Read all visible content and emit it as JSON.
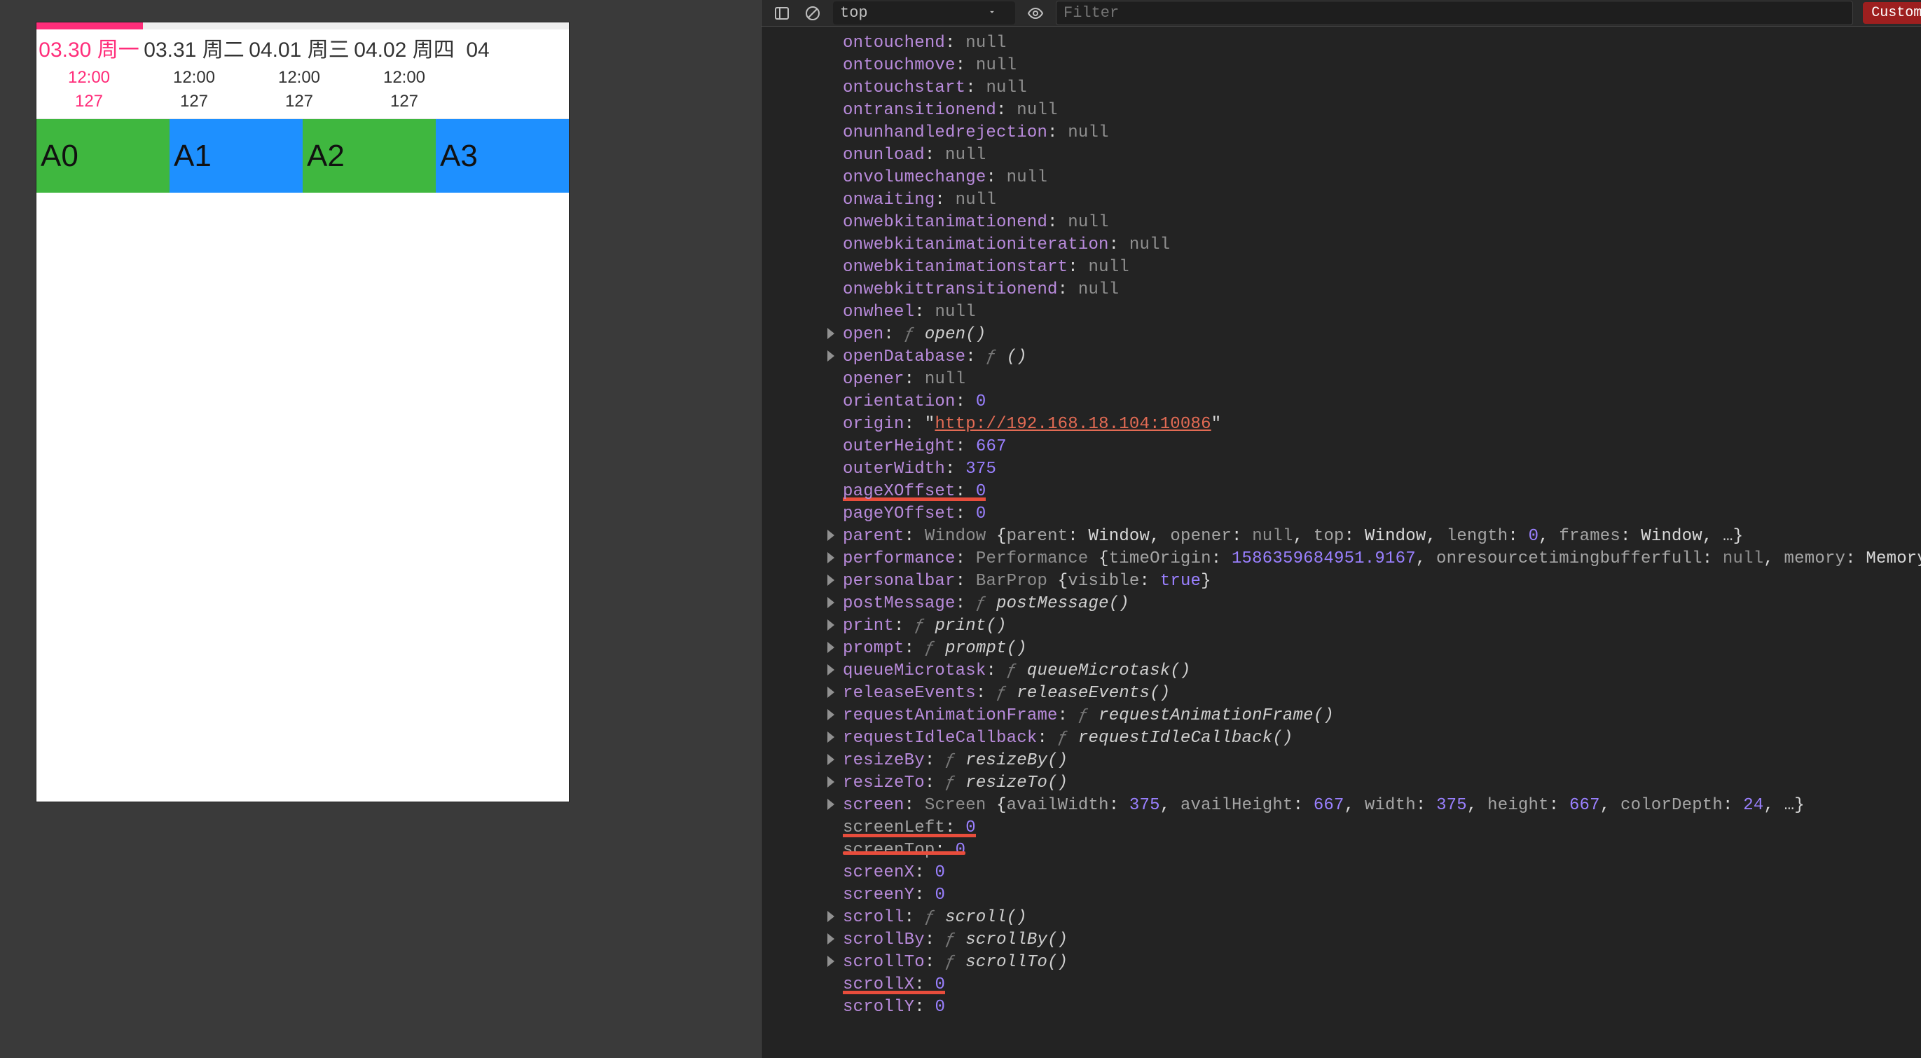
{
  "device": {
    "tabs": [
      {
        "date": "03.30 周一",
        "time": "12:00",
        "count": "127",
        "active": true
      },
      {
        "date": "03.31 周二",
        "time": "12:00",
        "count": "127",
        "active": false
      },
      {
        "date": "04.01 周三",
        "time": "12:00",
        "count": "127",
        "active": false
      },
      {
        "date": "04.02 周四",
        "time": "12:00",
        "count": "127",
        "active": false
      },
      {
        "date": "04",
        "time": "",
        "count": "",
        "active": false
      }
    ],
    "cells": [
      "A0",
      "A1",
      "A2",
      "A3"
    ]
  },
  "toolbar": {
    "context": "top",
    "filter_placeholder": "Filter",
    "badge": "Custom levels"
  },
  "props": [
    {
      "exp": false,
      "key": "ontouchend",
      "kind": "null",
      "val": "null"
    },
    {
      "exp": false,
      "key": "ontouchmove",
      "kind": "null",
      "val": "null"
    },
    {
      "exp": false,
      "key": "ontouchstart",
      "kind": "null",
      "val": "null"
    },
    {
      "exp": false,
      "key": "ontransitionend",
      "kind": "null",
      "val": "null"
    },
    {
      "exp": false,
      "key": "onunhandledrejection",
      "kind": "null",
      "val": "null"
    },
    {
      "exp": false,
      "key": "onunload",
      "kind": "null",
      "val": "null"
    },
    {
      "exp": false,
      "key": "onvolumechange",
      "kind": "null",
      "val": "null"
    },
    {
      "exp": false,
      "key": "onwaiting",
      "kind": "null",
      "val": "null"
    },
    {
      "exp": false,
      "key": "onwebkitanimationend",
      "kind": "null",
      "val": "null"
    },
    {
      "exp": false,
      "key": "onwebkitanimationiteration",
      "kind": "null",
      "val": "null"
    },
    {
      "exp": false,
      "key": "onwebkitanimationstart",
      "kind": "null",
      "val": "null"
    },
    {
      "exp": false,
      "key": "onwebkittransitionend",
      "kind": "null",
      "val": "null"
    },
    {
      "exp": false,
      "key": "onwheel",
      "kind": "null",
      "val": "null"
    },
    {
      "exp": true,
      "key": "open",
      "kind": "fn",
      "val": "open()"
    },
    {
      "exp": true,
      "key": "openDatabase",
      "kind": "fn",
      "val": "()"
    },
    {
      "exp": false,
      "key": "opener",
      "kind": "null",
      "val": "null"
    },
    {
      "exp": false,
      "key": "orientation",
      "kind": "num",
      "val": "0"
    },
    {
      "exp": false,
      "key": "origin",
      "kind": "origin",
      "val": "http://192.168.18.104:10086"
    },
    {
      "exp": false,
      "key": "outerHeight",
      "kind": "num",
      "val": "667"
    },
    {
      "exp": false,
      "key": "outerWidth",
      "kind": "num",
      "val": "375"
    },
    {
      "exp": false,
      "key": "pageXOffset",
      "kind": "num",
      "val": "0",
      "mark": "under"
    },
    {
      "exp": false,
      "key": "pageYOffset",
      "kind": "num",
      "val": "0"
    },
    {
      "exp": true,
      "key": "parent",
      "kind": "parent"
    },
    {
      "exp": true,
      "key": "performance",
      "kind": "performance"
    },
    {
      "exp": true,
      "key": "personalbar",
      "kind": "personalbar"
    },
    {
      "exp": true,
      "key": "postMessage",
      "kind": "fn",
      "val": "postMessage()"
    },
    {
      "exp": true,
      "key": "print",
      "kind": "fn",
      "val": "print()"
    },
    {
      "exp": true,
      "key": "prompt",
      "kind": "fn",
      "val": "prompt()"
    },
    {
      "exp": true,
      "key": "queueMicrotask",
      "kind": "fn",
      "val": "queueMicrotask()"
    },
    {
      "exp": true,
      "key": "releaseEvents",
      "kind": "fn",
      "val": "releaseEvents()"
    },
    {
      "exp": true,
      "key": "requestAnimationFrame",
      "kind": "fn",
      "val": "requestAnimationFrame()"
    },
    {
      "exp": true,
      "key": "requestIdleCallback",
      "kind": "fn",
      "val": "requestIdleCallback()"
    },
    {
      "exp": true,
      "key": "resizeBy",
      "kind": "fn",
      "val": "resizeBy()"
    },
    {
      "exp": true,
      "key": "resizeTo",
      "kind": "fn",
      "val": "resizeTo()"
    },
    {
      "exp": true,
      "key": "screen",
      "kind": "screen"
    },
    {
      "exp": false,
      "key": "screenLeft",
      "kind": "num",
      "val": "0",
      "mark": "under",
      "dim": true
    },
    {
      "exp": false,
      "key": "screenTop",
      "kind": "num",
      "val": "0",
      "mark": "strike",
      "dim": true
    },
    {
      "exp": false,
      "key": "screenX",
      "kind": "num",
      "val": "0"
    },
    {
      "exp": false,
      "key": "screenY",
      "kind": "num",
      "val": "0"
    },
    {
      "exp": true,
      "key": "scroll",
      "kind": "fn",
      "val": "scroll()"
    },
    {
      "exp": true,
      "key": "scrollBy",
      "kind": "fn",
      "val": "scrollBy()"
    },
    {
      "exp": true,
      "key": "scrollTo",
      "kind": "fn",
      "val": "scrollTo()"
    },
    {
      "exp": false,
      "key": "scrollX",
      "kind": "num",
      "val": "0",
      "mark": "under"
    },
    {
      "exp": false,
      "key": "scrollY",
      "kind": "num",
      "val": "0"
    }
  ],
  "complex": {
    "parent": {
      "type": "Window",
      "parts": [
        [
          "parent",
          "Window"
        ],
        [
          "opener",
          "null"
        ],
        [
          "top",
          "Window"
        ],
        [
          "length",
          "0"
        ],
        [
          "frames",
          "Window"
        ]
      ]
    },
    "performance": {
      "type": "Performance",
      "timeOrigin": "1586359684951.9167",
      "onresourcetimingbufferfull": "null",
      "memory": "MemoryInfo"
    },
    "personalbar": {
      "type": "BarProp",
      "visible": "true"
    },
    "screen": {
      "type": "Screen",
      "availWidth": "375",
      "availHeight": "667",
      "width": "375",
      "height": "667",
      "colorDepth": "24"
    }
  }
}
